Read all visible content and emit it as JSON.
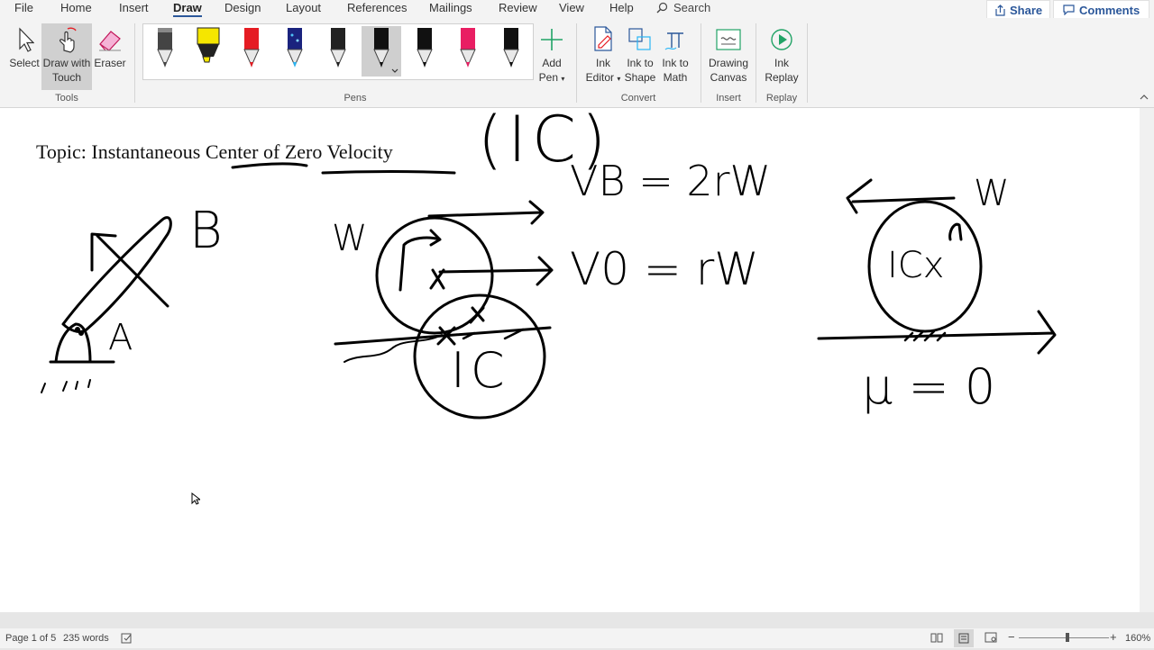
{
  "tabs": [
    "File",
    "Home",
    "Insert",
    "Draw",
    "Design",
    "Layout",
    "References",
    "Mailings",
    "Review",
    "View",
    "Help"
  ],
  "active_tab": "Draw",
  "search": {
    "label": "Search"
  },
  "share": {
    "label": "Share"
  },
  "comments": {
    "label": "Comments"
  },
  "ribbon": {
    "tools": {
      "select": "Select",
      "draw_touch": [
        "Draw with",
        "Touch"
      ],
      "eraser": "Eraser",
      "group": "Tools"
    },
    "pens": {
      "group": "Pens"
    },
    "add_pen": [
      "Add",
      "Pen"
    ],
    "convert": {
      "ink_editor": [
        "Ink",
        "Editor"
      ],
      "ink_shape": [
        "Ink to",
        "Shape"
      ],
      "ink_math": [
        "Ink to",
        "Math"
      ],
      "group": "Convert"
    },
    "insert": {
      "drawing_canvas": [
        "Drawing",
        "Canvas"
      ],
      "group": "Insert"
    },
    "replay": {
      "ink_replay": [
        "Ink",
        "Replay"
      ],
      "group": "Replay"
    }
  },
  "pen_colors": [
    "#444444",
    "#f5e600",
    "#e51c23",
    "#1e88e5",
    "#222222",
    "#111111",
    "#111111",
    "#e91e63",
    "#111111"
  ],
  "accent": "#2b579a",
  "document": {
    "title": "Topic: Instantaneous Center of Zero Velocity"
  },
  "ink_text": {
    "ic_top": "(IC)",
    "vb": "VB = 2rW",
    "vo": "V0 = rW",
    "b": "B",
    "a": "A",
    "w_left": "W",
    "w_right": "W",
    "ic": "IC",
    "ic_x": "ICx",
    "mu": "μ = 0"
  },
  "status": {
    "page": "Page 1 of 5",
    "words": "235 words",
    "zoom": "160%"
  }
}
